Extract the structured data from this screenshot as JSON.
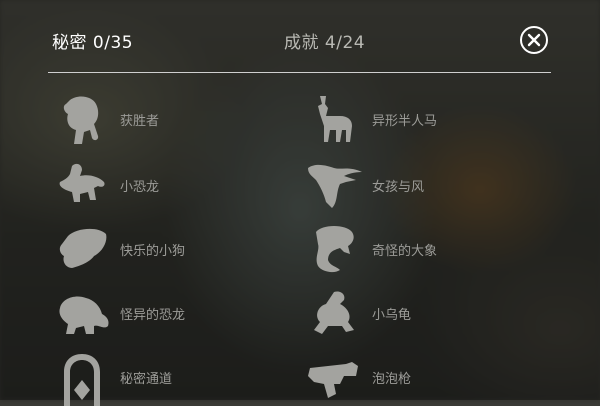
{
  "header": {
    "secrets_tab": "秘密 0/35",
    "achievements_tab": "成就 4/24",
    "close_icon": "close-circle-icon"
  },
  "items": [
    {
      "label": "获胜者",
      "icon": "elephant-icon"
    },
    {
      "label": "异形半人马",
      "icon": "centaur-icon"
    },
    {
      "label": "小恐龙",
      "icon": "small-dinosaur-icon"
    },
    {
      "label": "女孩与风",
      "icon": "girl-wind-icon"
    },
    {
      "label": "快乐的小狗",
      "icon": "dog-icon"
    },
    {
      "label": "奇怪的大象",
      "icon": "strange-elephant-icon"
    },
    {
      "label": "怪异的恐龙",
      "icon": "weird-dinosaur-icon"
    },
    {
      "label": "小乌龟",
      "icon": "turtle-icon"
    },
    {
      "label": "秘密通道",
      "icon": "secret-door-icon"
    },
    {
      "label": "泡泡枪",
      "icon": "bubble-gun-icon"
    }
  ],
  "colors": {
    "active_tab": "#ffffff",
    "inactive_tab": "#b9b9b3",
    "item_label": "#9c9c98",
    "icon_fill": "#a3a39f"
  }
}
